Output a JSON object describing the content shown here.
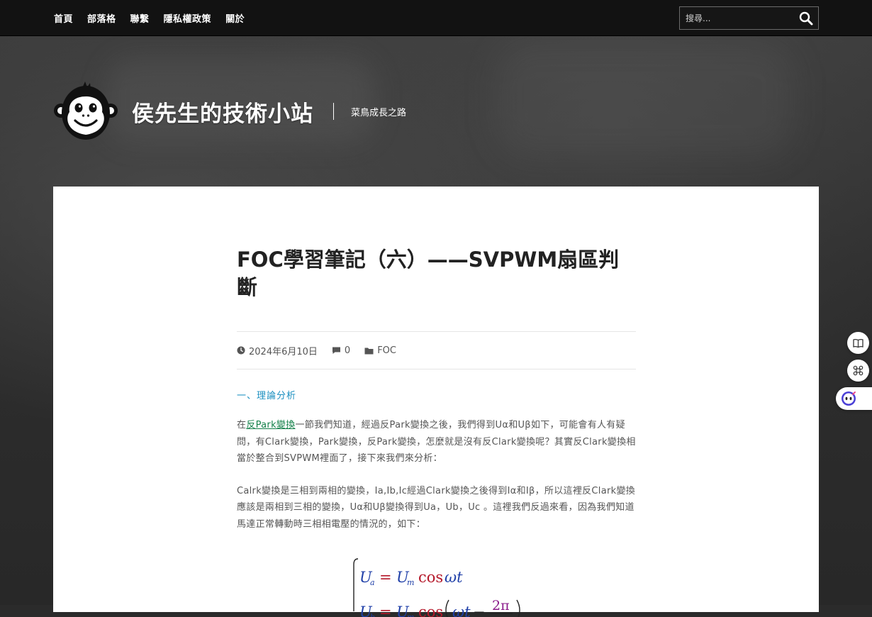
{
  "nav": {
    "items": [
      {
        "label": "首頁"
      },
      {
        "label": "部落格"
      },
      {
        "label": "聯繫"
      },
      {
        "label": "隱私權政策"
      },
      {
        "label": "關於"
      }
    ]
  },
  "search": {
    "placeholder": "搜尋..."
  },
  "site": {
    "title": "侯先生的技術小站",
    "tagline": "菜鳥成長之路"
  },
  "post": {
    "title": "FOC學習筆記（六）——SVPWM扇區判斷",
    "date": "2024年6月10日",
    "comments": "0",
    "category": "FOC",
    "section_heading": "一、理論分析",
    "p1": {
      "prefix": "在",
      "link": "反Park變換",
      "rest": "一節我們知道，經過反Park變換之後，我們得到Uα和Uβ如下，可能會有人有疑問，有Clark變換，Park變換，反Park變換，怎麼就是沒有反Clark變換呢？其實反Clark變換相當於整合到SVPWM裡面了，接下來我們來分析："
    },
    "p2": "Calrk變換是三相到兩相的變換，Ia,Ib,Ic經過Clark變換之後得到Iα和Iβ，所以這裡反Clark變換應該是兩相到三相的變換，Uα和Uβ變換得到Ua，Ub，Uc 。這裡我們反過來看，因為我們知道馬達正常轉動時三相相電壓的情況的，如下："
  },
  "colors": {
    "topbar": "#121212",
    "accent_link": "#14804a",
    "section_heading": "#1a8fc0",
    "math_var": "#1f3fa8",
    "math_func": "#b5182a"
  }
}
